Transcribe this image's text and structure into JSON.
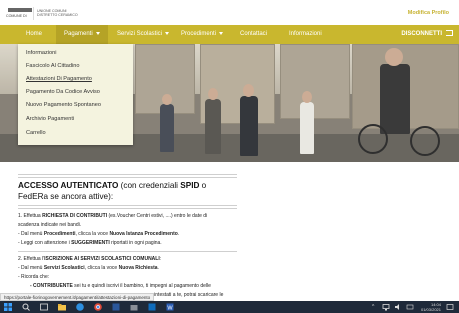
{
  "header": {
    "logo_line1": "COMUNE DI",
    "logo_line2": "UNIONE COMUNI",
    "logo_line3": "DISTRETTO CERAMICO",
    "profile_link": "Modifica Profilo"
  },
  "navbar": {
    "items": [
      {
        "label": "Home"
      },
      {
        "label": "Pagamenti"
      },
      {
        "label": "Servizi Scolastici"
      },
      {
        "label": "Procedimenti"
      },
      {
        "label": "Contattaci"
      },
      {
        "label": "Informazioni"
      }
    ],
    "logout": "DISCONNETTI",
    "active_color": "#b5a326",
    "bar_color": "#c9b72e"
  },
  "dropdown": {
    "items": [
      {
        "label": "Informazioni"
      },
      {
        "label": "Fascicolo Al Cittadino"
      },
      {
        "label": "Attestazioni Di Pagamento"
      },
      {
        "label": "Pagamento Da Codice Avviso"
      },
      {
        "label": "Nuovo Pagamento Spontaneo"
      },
      {
        "label": "Archivio Pagamenti"
      },
      {
        "label": "Carrello"
      }
    ],
    "highlighted_index": 2
  },
  "main": {
    "heading_bold": "ACCESSO AUTENTICATO",
    "heading_rest1": " (con credenziali ",
    "heading_spid": "SPID",
    "heading_rest2": " o FedERa se ancora attive):",
    "p1_l1_pre": "1. Effettua ",
    "p1_l1_bold": "RICHIESTA DI CONTRIBUTI",
    "p1_l1_post": " (es.Voucher Centri estivi, ....) entro le date di",
    "p1_l2": "scadenza indicate nei bandi.",
    "p1_l3_pre": "- Dal menù ",
    "p1_l3_bold": "Procedimenti",
    "p1_l3_mid": ", clicca la voce ",
    "p1_l3_bold2": "Nuova Istanza Procedimento",
    "p1_l3_post": ".",
    "p1_l4_pre": "- Leggi con attenzione i ",
    "p1_l4_bold": "SUGGERIMENTI",
    "p1_l4_post": " riportati in ogni pagina.",
    "p2_l1_pre": "2. Effettua l'",
    "p2_l1_bold": "ISCRIZIONE AI SERVIZI SCOLASTICI COMUNALI",
    "p2_l1_post": ":",
    "p2_l2_pre": "- Dal menù ",
    "p2_l2_bold": "Servizi Scolastici",
    "p2_l2_mid": ", clicca la voce ",
    "p2_l2_bold2": "Nuova Richiesta",
    "p2_l2_post": ".",
    "p2_l3": "- Ricorda che:",
    "p2_l4_bold": "- CONTRIBUENTE",
    "p2_l4_post": " sei tu e quindi iscrivi il bambino, ti impegni al pagamento delle",
    "p2_l5_post": "...intestati a te, potrai scaricare le"
  },
  "status_url": "https://portale-fiorinogovernement.it/pagamenti/attestazioni-di-pagamento",
  "taskbar": {
    "time": "14:04",
    "date": "01/03/2021"
  }
}
